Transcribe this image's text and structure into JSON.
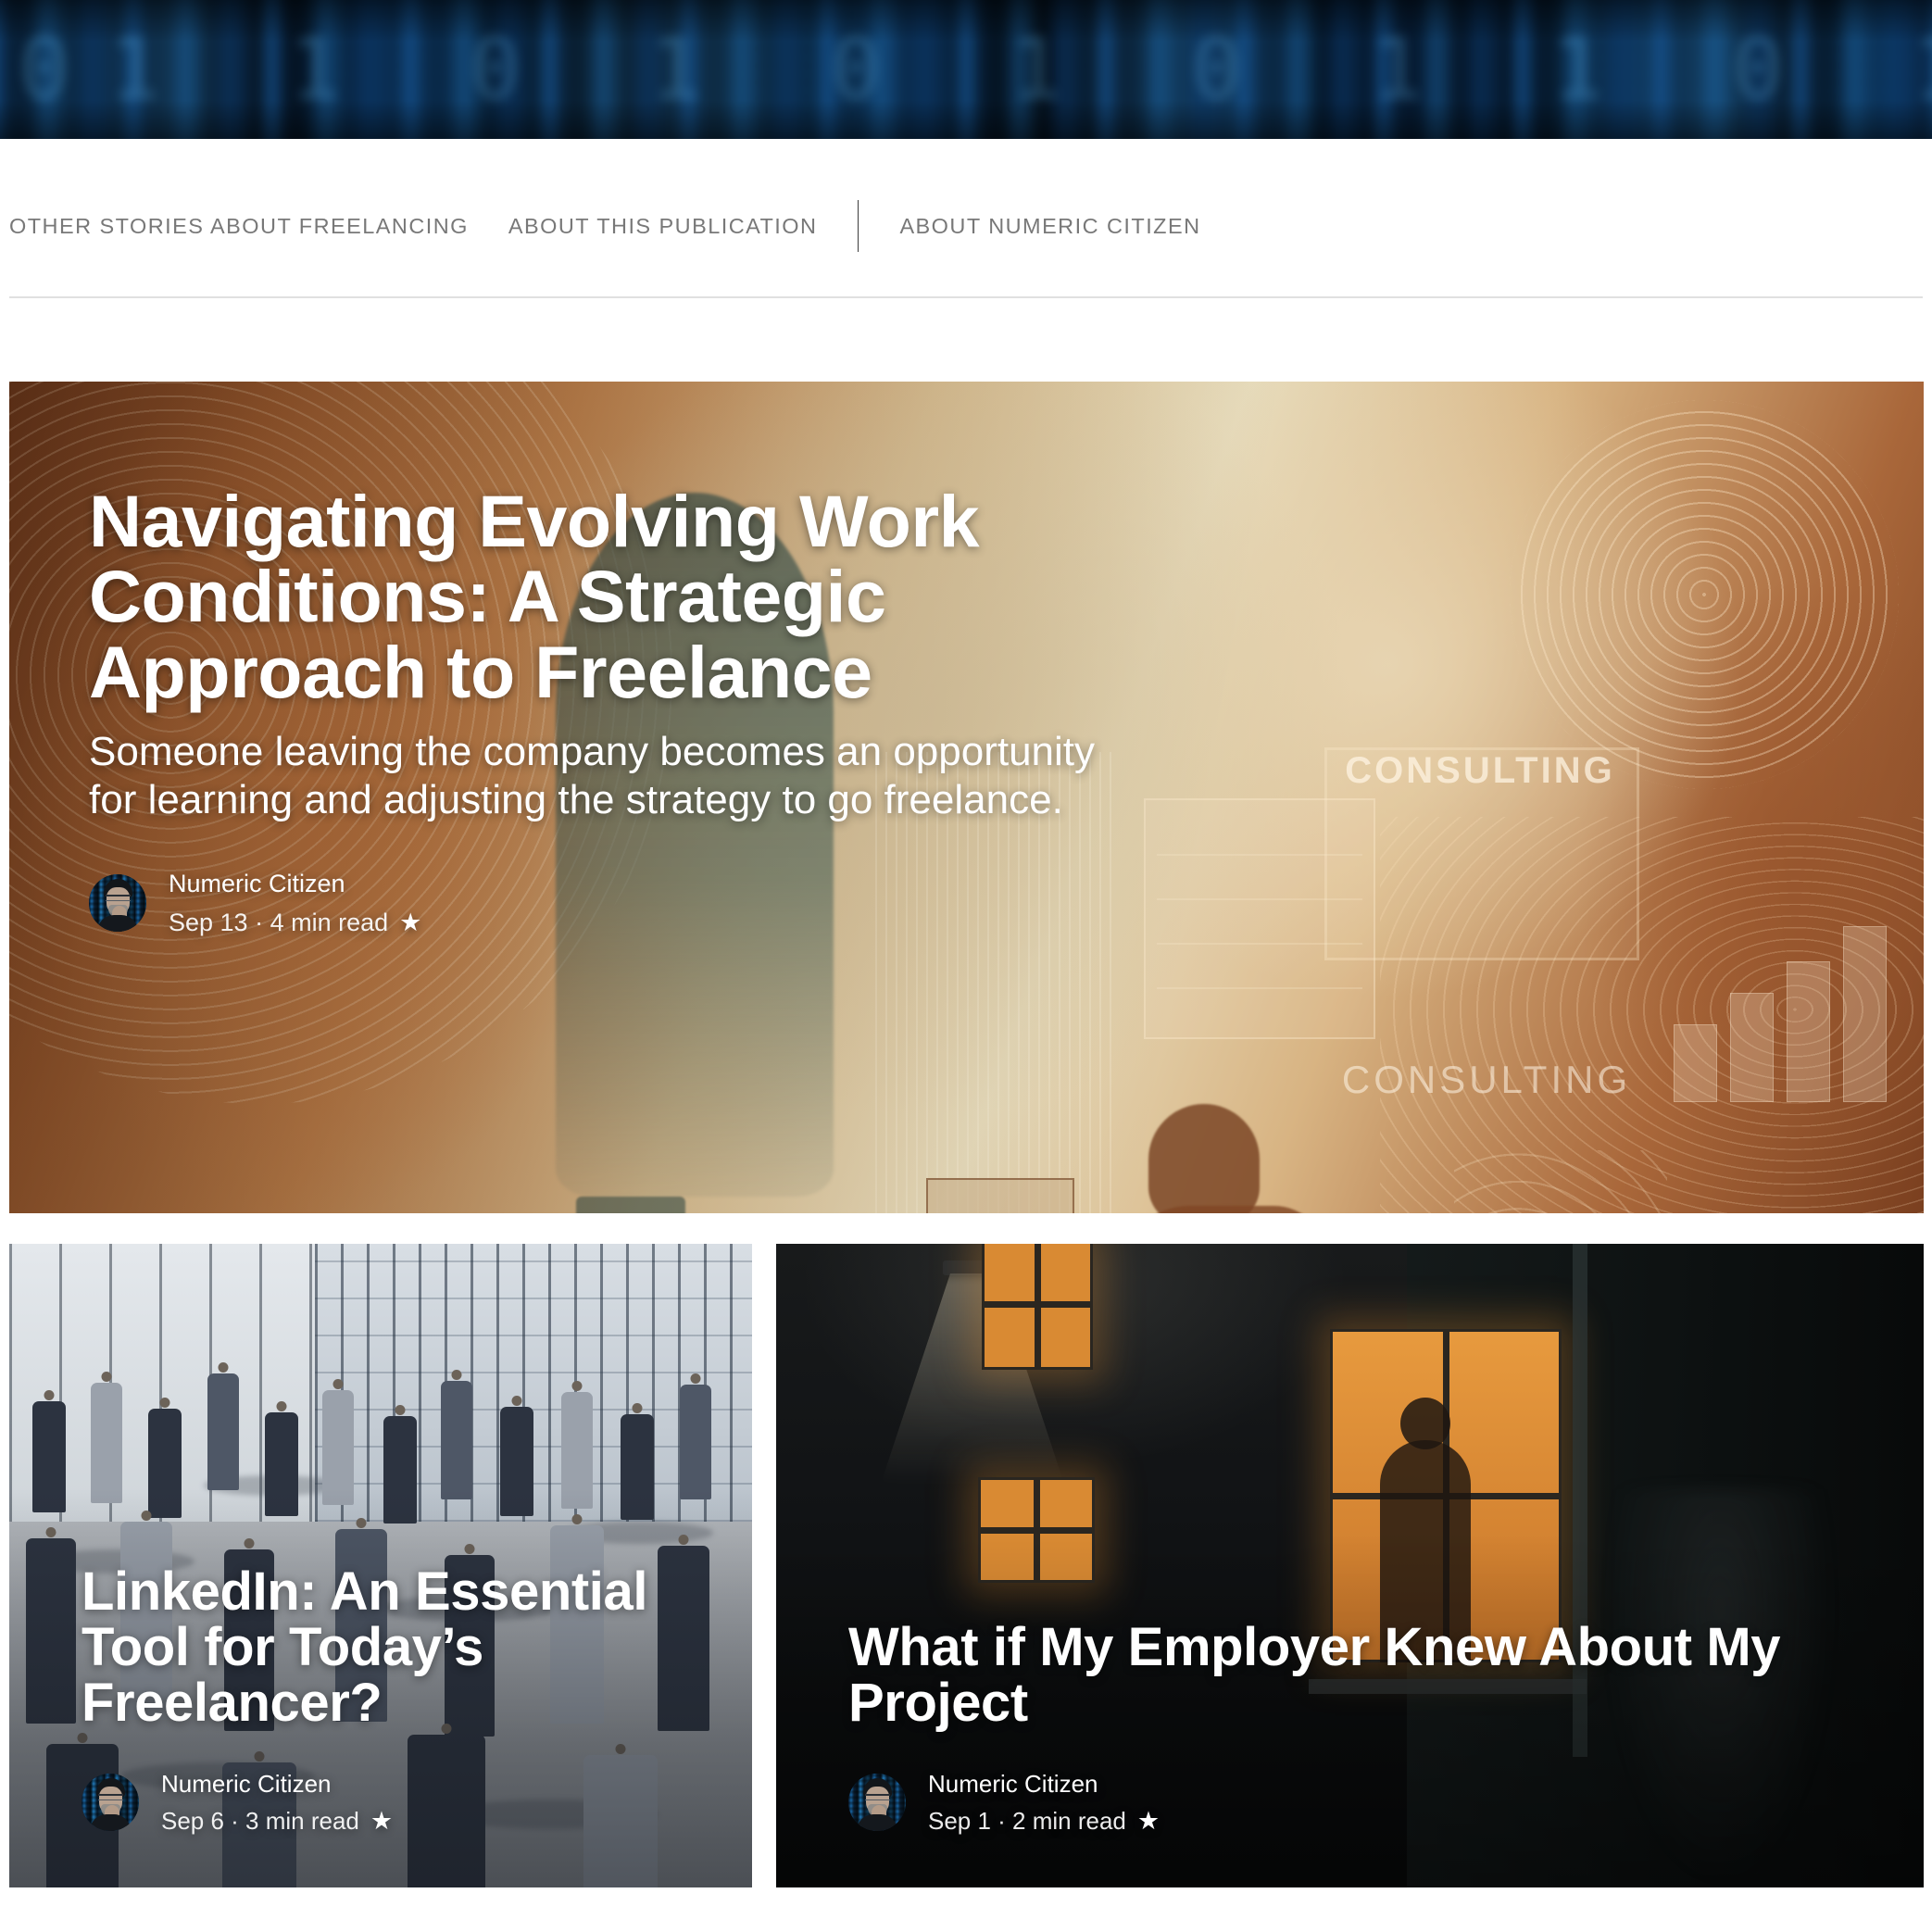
{
  "banner": {
    "name": "matrix-code-banner",
    "glyphs": "01 1 0 1 0 1 0 1 1 0 1 0 1 1 0 1 0"
  },
  "nav": {
    "items": [
      {
        "label": "OTHER STORIES ABOUT FREELANCING"
      },
      {
        "label": "ABOUT THIS PUBLICATION"
      },
      {
        "label": "ABOUT NUMERIC CITIZEN"
      }
    ]
  },
  "hero": {
    "title": "Navigating Evolving Work Conditions: A Strategic Approach to Freelance",
    "subtitle": "Someone leaving the company becomes an opportunity for learning and adjusting the strategy to go freelance.",
    "author": "Numeric Citizen",
    "dateline": "Sep 13 · 4 min read",
    "star": "★",
    "art_text_1": "CONSULTING",
    "art_text_2": "CONSULTING"
  },
  "cards": [
    {
      "title": "LinkedIn: An Essential Tool for Today’s Freelancer?",
      "author": "Numeric Citizen",
      "dateline": "Sep 6 · 3 min read",
      "star": "★"
    },
    {
      "title": "What if My Employer Knew About My Project",
      "author": "Numeric Citizen",
      "dateline": "Sep 1 · 2 min read",
      "star": "★"
    }
  ],
  "colors": {
    "nav_text": "#787878",
    "rule": "#e0e0e0",
    "page_bg": "#ffffff",
    "banner_bg": "#030507",
    "hero_accent": "#b4773f",
    "card_right_bg": "#121214"
  }
}
